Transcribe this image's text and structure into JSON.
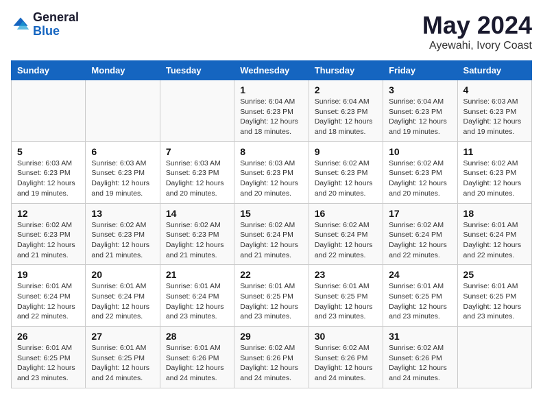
{
  "logo": {
    "general": "General",
    "blue": "Blue"
  },
  "title": "May 2024",
  "subtitle": "Ayewahi, Ivory Coast",
  "headers": [
    "Sunday",
    "Monday",
    "Tuesday",
    "Wednesday",
    "Thursday",
    "Friday",
    "Saturday"
  ],
  "weeks": [
    [
      {
        "day": "",
        "info": ""
      },
      {
        "day": "",
        "info": ""
      },
      {
        "day": "",
        "info": ""
      },
      {
        "day": "1",
        "info": "Sunrise: 6:04 AM\nSunset: 6:23 PM\nDaylight: 12 hours\nand 18 minutes."
      },
      {
        "day": "2",
        "info": "Sunrise: 6:04 AM\nSunset: 6:23 PM\nDaylight: 12 hours\nand 18 minutes."
      },
      {
        "day": "3",
        "info": "Sunrise: 6:04 AM\nSunset: 6:23 PM\nDaylight: 12 hours\nand 19 minutes."
      },
      {
        "day": "4",
        "info": "Sunrise: 6:03 AM\nSunset: 6:23 PM\nDaylight: 12 hours\nand 19 minutes."
      }
    ],
    [
      {
        "day": "5",
        "info": "Sunrise: 6:03 AM\nSunset: 6:23 PM\nDaylight: 12 hours\nand 19 minutes."
      },
      {
        "day": "6",
        "info": "Sunrise: 6:03 AM\nSunset: 6:23 PM\nDaylight: 12 hours\nand 19 minutes."
      },
      {
        "day": "7",
        "info": "Sunrise: 6:03 AM\nSunset: 6:23 PM\nDaylight: 12 hours\nand 20 minutes."
      },
      {
        "day": "8",
        "info": "Sunrise: 6:03 AM\nSunset: 6:23 PM\nDaylight: 12 hours\nand 20 minutes."
      },
      {
        "day": "9",
        "info": "Sunrise: 6:02 AM\nSunset: 6:23 PM\nDaylight: 12 hours\nand 20 minutes."
      },
      {
        "day": "10",
        "info": "Sunrise: 6:02 AM\nSunset: 6:23 PM\nDaylight: 12 hours\nand 20 minutes."
      },
      {
        "day": "11",
        "info": "Sunrise: 6:02 AM\nSunset: 6:23 PM\nDaylight: 12 hours\nand 20 minutes."
      }
    ],
    [
      {
        "day": "12",
        "info": "Sunrise: 6:02 AM\nSunset: 6:23 PM\nDaylight: 12 hours\nand 21 minutes."
      },
      {
        "day": "13",
        "info": "Sunrise: 6:02 AM\nSunset: 6:23 PM\nDaylight: 12 hours\nand 21 minutes."
      },
      {
        "day": "14",
        "info": "Sunrise: 6:02 AM\nSunset: 6:23 PM\nDaylight: 12 hours\nand 21 minutes."
      },
      {
        "day": "15",
        "info": "Sunrise: 6:02 AM\nSunset: 6:24 PM\nDaylight: 12 hours\nand 21 minutes."
      },
      {
        "day": "16",
        "info": "Sunrise: 6:02 AM\nSunset: 6:24 PM\nDaylight: 12 hours\nand 22 minutes."
      },
      {
        "day": "17",
        "info": "Sunrise: 6:02 AM\nSunset: 6:24 PM\nDaylight: 12 hours\nand 22 minutes."
      },
      {
        "day": "18",
        "info": "Sunrise: 6:01 AM\nSunset: 6:24 PM\nDaylight: 12 hours\nand 22 minutes."
      }
    ],
    [
      {
        "day": "19",
        "info": "Sunrise: 6:01 AM\nSunset: 6:24 PM\nDaylight: 12 hours\nand 22 minutes."
      },
      {
        "day": "20",
        "info": "Sunrise: 6:01 AM\nSunset: 6:24 PM\nDaylight: 12 hours\nand 22 minutes."
      },
      {
        "day": "21",
        "info": "Sunrise: 6:01 AM\nSunset: 6:24 PM\nDaylight: 12 hours\nand 23 minutes."
      },
      {
        "day": "22",
        "info": "Sunrise: 6:01 AM\nSunset: 6:25 PM\nDaylight: 12 hours\nand 23 minutes."
      },
      {
        "day": "23",
        "info": "Sunrise: 6:01 AM\nSunset: 6:25 PM\nDaylight: 12 hours\nand 23 minutes."
      },
      {
        "day": "24",
        "info": "Sunrise: 6:01 AM\nSunset: 6:25 PM\nDaylight: 12 hours\nand 23 minutes."
      },
      {
        "day": "25",
        "info": "Sunrise: 6:01 AM\nSunset: 6:25 PM\nDaylight: 12 hours\nand 23 minutes."
      }
    ],
    [
      {
        "day": "26",
        "info": "Sunrise: 6:01 AM\nSunset: 6:25 PM\nDaylight: 12 hours\nand 23 minutes."
      },
      {
        "day": "27",
        "info": "Sunrise: 6:01 AM\nSunset: 6:25 PM\nDaylight: 12 hours\nand 24 minutes."
      },
      {
        "day": "28",
        "info": "Sunrise: 6:01 AM\nSunset: 6:26 PM\nDaylight: 12 hours\nand 24 minutes."
      },
      {
        "day": "29",
        "info": "Sunrise: 6:02 AM\nSunset: 6:26 PM\nDaylight: 12 hours\nand 24 minutes."
      },
      {
        "day": "30",
        "info": "Sunrise: 6:02 AM\nSunset: 6:26 PM\nDaylight: 12 hours\nand 24 minutes."
      },
      {
        "day": "31",
        "info": "Sunrise: 6:02 AM\nSunset: 6:26 PM\nDaylight: 12 hours\nand 24 minutes."
      },
      {
        "day": "",
        "info": ""
      }
    ]
  ]
}
